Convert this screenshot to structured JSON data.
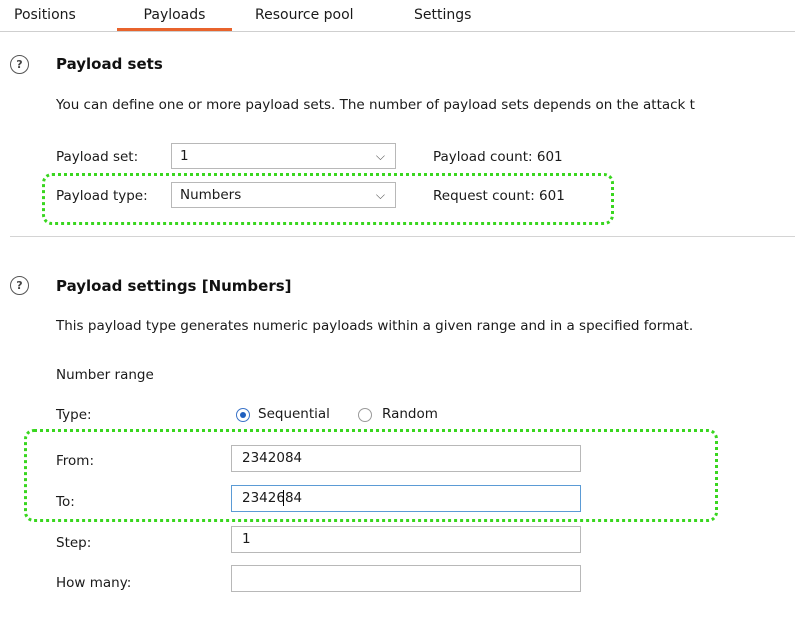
{
  "tabs": [
    "Positions",
    "Payloads",
    "Resource pool",
    "Settings"
  ],
  "active_tab": "Payloads",
  "payload_sets": {
    "title": "Payload sets",
    "description": "You can define one or more payload sets. The number of payload sets depends on the attack t",
    "payload_set_label": "Payload set:",
    "payload_set_value": "1",
    "payload_count_label": "Payload count: 601",
    "payload_type_label": "Payload type:",
    "payload_type_value": "Numbers",
    "request_count_label": "Request count: 601"
  },
  "payload_settings": {
    "title": "Payload settings [Numbers]",
    "description": "This payload type generates numeric payloads within a given range and in a specified format.",
    "number_range_label": "Number range",
    "type_label": "Type:",
    "sequential_label": "Sequential",
    "random_label": "Random",
    "from_label": "From:",
    "from_value": "2342084",
    "to_label": "To:",
    "to_value": "2342684",
    "step_label": "Step:",
    "step_value": "1",
    "how_many_label": "How many:",
    "how_many_value": ""
  },
  "icons": {
    "help": "help-icon",
    "chevron": "chevron-down-icon"
  },
  "colors": {
    "active_tab_underline": "#e8632c",
    "highlight": "#39d61f",
    "radio_selected": "#1f5fbf",
    "focused_border": "#5b9bd5"
  }
}
